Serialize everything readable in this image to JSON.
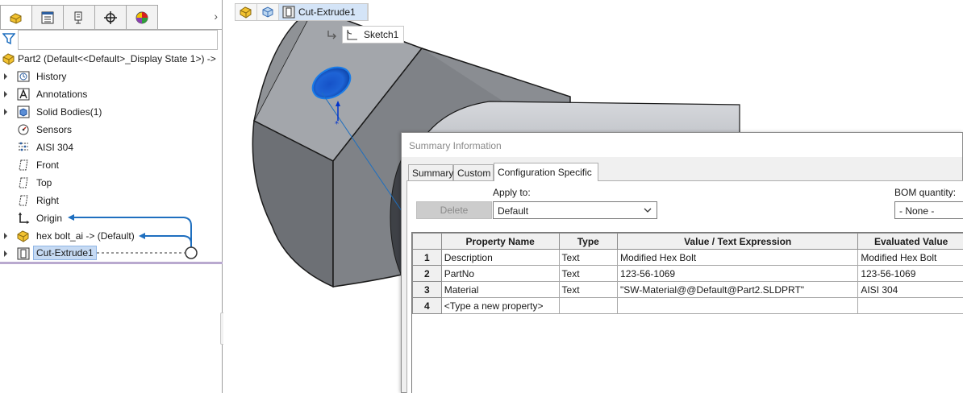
{
  "feature_manager": {
    "tabs": [
      {
        "icon": "feature-tree-icon",
        "active": true
      },
      {
        "icon": "property-manager-icon"
      },
      {
        "icon": "configuration-manager-icon"
      },
      {
        "icon": "dimxpert-icon"
      },
      {
        "icon": "display-manager-icon"
      }
    ],
    "tree": {
      "root_label": "Part2  (Default<<Default>_Display State 1>) ->",
      "items": [
        {
          "label": "History",
          "icon": "history-icon",
          "expandable": true
        },
        {
          "label": "Annotations",
          "icon": "annotations-icon",
          "expandable": true
        },
        {
          "label": "Solid Bodies(1)",
          "icon": "solid-bodies-icon",
          "expandable": true
        },
        {
          "label": "Sensors",
          "icon": "sensors-icon",
          "expandable": false
        },
        {
          "label": "AISI 304",
          "icon": "material-icon",
          "expandable": false
        },
        {
          "label": "Front",
          "icon": "plane-icon",
          "expandable": false
        },
        {
          "label": "Top",
          "icon": "plane-icon",
          "expandable": false
        },
        {
          "label": "Right",
          "icon": "plane-icon",
          "expandable": false
        },
        {
          "label": "Origin",
          "icon": "origin-icon",
          "expandable": false
        },
        {
          "label": "hex bolt_ai -> (Default)",
          "icon": "part-icon",
          "expandable": true
        },
        {
          "label": "Cut-Extrude1",
          "icon": "cut-extrude-icon",
          "expandable": true,
          "selected": true
        }
      ]
    }
  },
  "breadcrumb": {
    "feature_label": "Cut-Extrude1",
    "sketch_label": "Sketch1"
  },
  "dialog": {
    "title": "Summary Information",
    "tabs": [
      {
        "label": "Summary"
      },
      {
        "label": "Custom"
      },
      {
        "label": "Configuration Specific",
        "active": true
      }
    ],
    "delete_label": "Delete",
    "apply_to_label": "Apply to:",
    "apply_to_value": "Default",
    "bom_label": "BOM quantity:",
    "bom_value": "- None -",
    "table": {
      "headers": [
        "Property Name",
        "Type",
        "Value / Text Expression",
        "Evaluated Value"
      ],
      "rows": [
        {
          "num": "1",
          "name": "Description",
          "type": "Text",
          "expression": "Modified Hex Bolt",
          "evaluated": "Modified Hex Bolt"
        },
        {
          "num": "2",
          "name": "PartNo",
          "type": "Text",
          "expression": "123-56-1069",
          "evaluated": "123-56-1069"
        },
        {
          "num": "3",
          "name": "Material",
          "type": "Text",
          "expression": "\"SW-Material@@Default@Part2.SLDPRT\"",
          "evaluated": "AISI 304"
        },
        {
          "num": "4",
          "name": "<Type a new property>",
          "type": "",
          "expression": "",
          "evaluated": ""
        }
      ]
    }
  },
  "colors": {
    "accent": "#1f6fbf",
    "selection": "#c6daf3",
    "model_face": "#a6a9ae",
    "hole": "#1e64d6"
  }
}
